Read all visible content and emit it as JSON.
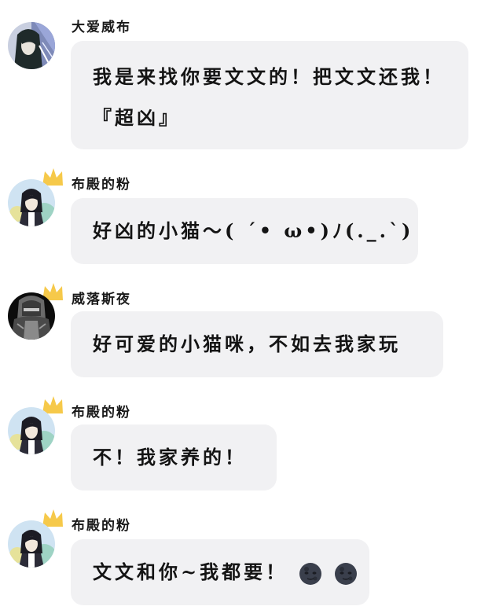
{
  "messages": [
    {
      "sender": "大爱威布",
      "text": "我是来找你要文文的！把文文还我！『超凶』",
      "crown": false,
      "avatar_icon": "long-hair-character-avatar-icon"
    },
    {
      "sender": "布殿的粉",
      "text": "好凶的小猫～( ´• ω•)ﾉ(._.`)",
      "crown": true,
      "avatar_icon": "anime-boy-avatar-icon"
    },
    {
      "sender": "威落斯夜",
      "text": "好可爱的小猫咪，不如去我家玩",
      "crown": true,
      "avatar_icon": "dark-knight-avatar-icon"
    },
    {
      "sender": "布殿的粉",
      "text": "不！我家养的！",
      "crown": true,
      "avatar_icon": "anime-boy-avatar-icon"
    },
    {
      "sender": "布殿的粉",
      "text": "文文和你~我都要！",
      "crown": true,
      "avatar_icon": "anime-boy-avatar-icon",
      "emoji": [
        "new-moon-face-icon",
        "new-moon-face-icon"
      ]
    }
  ],
  "colors": {
    "bubble": "#f1f1f3",
    "crown": "#f6c94a",
    "text": "#141414"
  }
}
